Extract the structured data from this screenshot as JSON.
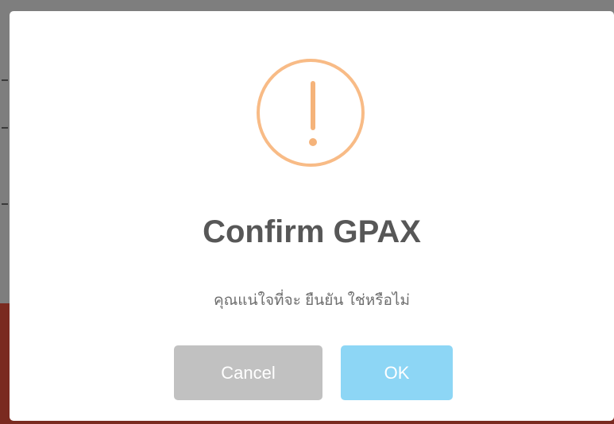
{
  "dialog": {
    "title": "Confirm GPAX",
    "message": "คุณแน่ใจที่จะ ยืนยัน ใช่หรือไม่",
    "icon": "warning-icon",
    "icon_color": "#f8bb86",
    "buttons": {
      "cancel_label": "Cancel",
      "ok_label": "OK"
    },
    "colors": {
      "cancel_button": "#c1c1c1",
      "ok_button": "#8dd6f5"
    }
  }
}
